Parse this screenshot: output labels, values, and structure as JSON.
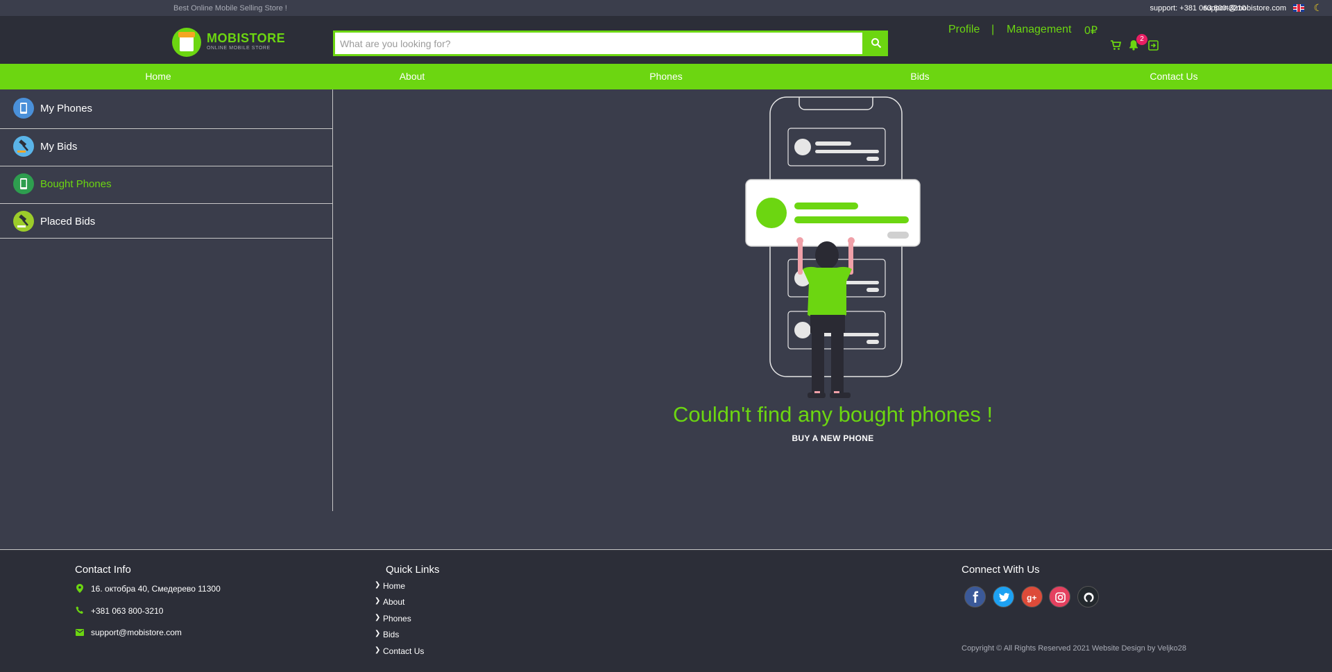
{
  "topbar": {
    "tagline": "Best Online Mobile Selling Store !",
    "support": "support: +381 063 800-3210",
    "email": "support@mobistore.com"
  },
  "logo": {
    "title": "MOBISTORE",
    "subtitle": "ONLINE MOBILE STORE"
  },
  "search": {
    "placeholder": "What are you looking for?",
    "value": ""
  },
  "header_nav": {
    "profile": "Profile",
    "separator": "|",
    "management": "Management",
    "balance": "0₽",
    "notification_count": "2"
  },
  "menu": [
    "Home",
    "About",
    "Phones",
    "Bids",
    "Contact Us"
  ],
  "sidebar": {
    "items": [
      {
        "label": "My Phones",
        "icon": "phone-icon"
      },
      {
        "label": "My Bids",
        "icon": "gavel-icon"
      },
      {
        "label": "Bought Phones",
        "icon": "phone-icon",
        "active": true
      },
      {
        "label": "Placed Bids",
        "icon": "gavel-icon"
      }
    ]
  },
  "main": {
    "message": "Couldn't find any bought phones !",
    "action": "BUY A NEW PHONE"
  },
  "footer": {
    "contact_title": "Contact Info",
    "address": "16. октобра 40, Смедерево 11300",
    "phone": "+381 063 800-3210",
    "email": "support@mobistore.com",
    "links_title": "Quick Links",
    "links": [
      "Home",
      "About",
      "Phones",
      "Bids",
      "Contact Us"
    ],
    "connect_title": "Connect With Us",
    "socials": [
      "facebook-icon",
      "twitter-icon",
      "google-plus-icon",
      "instagram-icon",
      "github-icon"
    ],
    "copyright": "Copyright © All Rights Reserved 2021 Website Design by Veljko28"
  },
  "colors": {
    "accent": "#6cd611",
    "background": "#3a3d4b",
    "header": "#2c2e38",
    "badge": "#e91e63"
  }
}
